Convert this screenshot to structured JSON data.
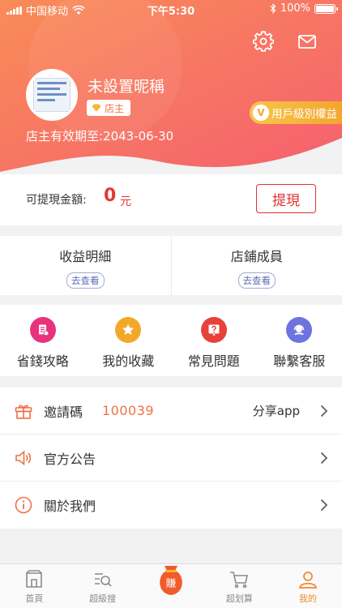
{
  "status_bar": {
    "carrier": "中国移动",
    "time": "下午5:30",
    "battery": "100%"
  },
  "header": {
    "settings_icon": "gear-icon",
    "mail_icon": "mail-icon",
    "nickname": "未設置昵稱",
    "role_badge": "店主",
    "expiry": "店主有效期至:2043-06-30",
    "level_pill": "用戶級別權益",
    "level_mark": "V"
  },
  "balance": {
    "label": "可提現金額:",
    "amount": "0",
    "unit": "元",
    "withdraw_label": "提現"
  },
  "cards": [
    {
      "title": "收益明細",
      "action": "去查看"
    },
    {
      "title": "店鋪成員",
      "action": "去查看"
    }
  ],
  "shortcuts": [
    {
      "label": "省錢攻略",
      "icon": "coupon-icon",
      "color": "#e8327e"
    },
    {
      "label": "我的收藏",
      "icon": "star-icon",
      "color": "#f4a82a"
    },
    {
      "label": "常見問題",
      "icon": "question-icon",
      "color": "#e8413c"
    },
    {
      "label": "聯繫客服",
      "icon": "headset-icon",
      "color": "#6d74e0"
    }
  ],
  "list": {
    "invite": {
      "label": "邀請碼",
      "code": "100039",
      "right": "分享app"
    },
    "notice": {
      "label": "官方公告"
    },
    "about": {
      "label": "關於我們"
    }
  },
  "tabbar": [
    {
      "label": "首頁"
    },
    {
      "label": "超級搜"
    },
    {
      "label": "賺"
    },
    {
      "label": "超划算"
    },
    {
      "label": "我的"
    }
  ],
  "colors": {
    "header_top": "#f8825b",
    "header_bottom": "#f6686f",
    "accent": "#f08a30",
    "price_red": "#e23a3a"
  }
}
